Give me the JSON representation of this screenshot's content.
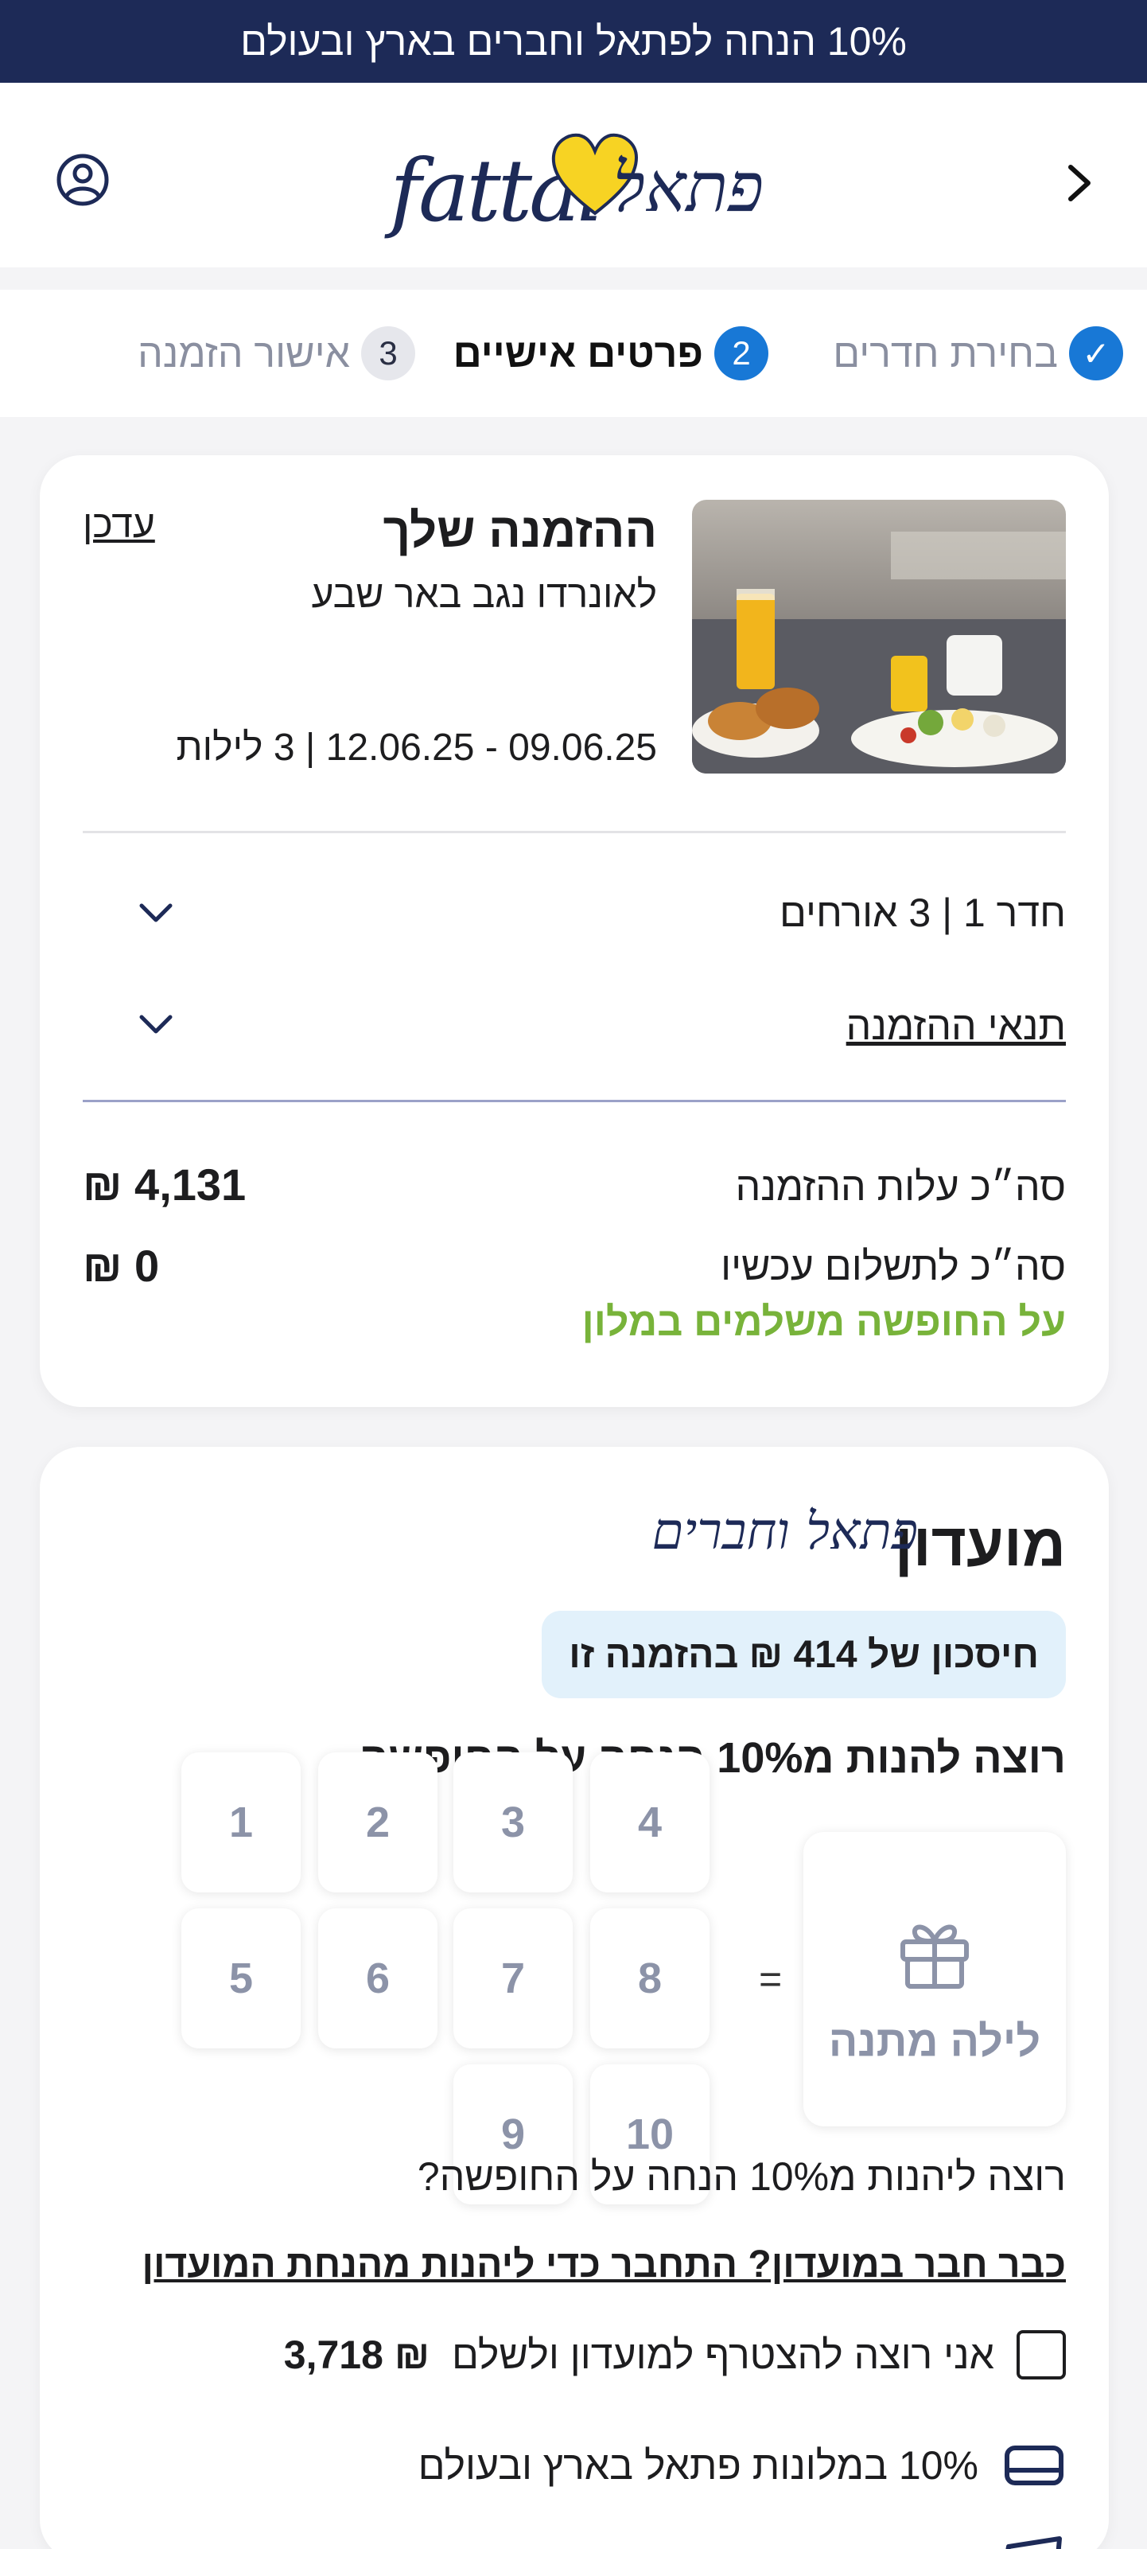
{
  "promo": {
    "text": "10% הנחה לפתאל וחברים בארץ ובעולם"
  },
  "header": {
    "back_icon": "chevron-right-icon",
    "user_icon": "user-circle-icon",
    "logo_latin": "fattal",
    "logo_hebrew": "פתאל"
  },
  "stepper": {
    "steps": [
      {
        "number": "✓",
        "label": "בחירת חדרים",
        "state": "done"
      },
      {
        "number": "2",
        "label": "פרטים אישיים",
        "state": "active"
      },
      {
        "number": "3",
        "label": "אישור הזמנה",
        "state": "todo"
      }
    ]
  },
  "booking": {
    "title": "ההזמנה שלך",
    "hotel": "לאונרדו נגב באר שבע",
    "dates": "09.06.25 - 12.06.25 | 3 לילות",
    "update_link": "עדכן",
    "room_row": "חדר 1 | 3 אורחים",
    "terms_row": "תנאי ההזמנה",
    "total_label": "סה״כ עלות ההזמנה",
    "total_value": "₪ 4,131",
    "pay_now_label": "סה״כ לתשלום עכשיו",
    "pay_now_value": "₪ 0",
    "pay_note": "על החופשה משלמים במלון"
  },
  "club": {
    "title": "מועדון",
    "script_name": "פתאל וחברים",
    "saving": "חיסכון של 414 ₪ בהזמנה זו",
    "question_bold": "רוצה להנות מ10% הנחה על החופשה",
    "gift_label": "לילה מתנה",
    "equals": "=",
    "nights": [
      "1",
      "2",
      "3",
      "4",
      "5",
      "6",
      "7",
      "8",
      "9",
      "10"
    ],
    "question": "רוצה ליהנות מ10% הנחה על החופשה?",
    "member_link": "כבר חבר במועדון? התחבר כדי ליהנות מהנחת המועדון",
    "join_text": "אני רוצה להצטרף למועדון ולשלם",
    "join_price": "₪ 3,718",
    "perk_text": "10% במלונות פתאל בארץ ובעולם"
  },
  "colors": {
    "navy": "#1d2a57",
    "step_blue": "#1878d6",
    "green_note": "#78b33a",
    "saving_bg": "#e2f1fb"
  }
}
